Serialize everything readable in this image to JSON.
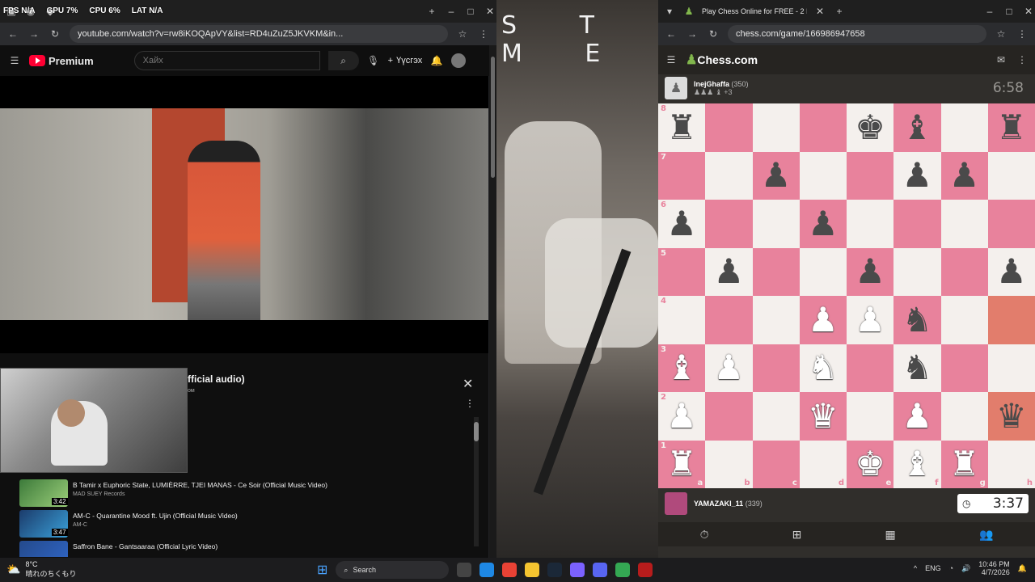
{
  "overlay": {
    "fps": "FPS N/A",
    "gpu": "GPU 7%",
    "cpu": "CPU 6%",
    "lat": "LAT N/A"
  },
  "youtube": {
    "url": "youtube.com/watch?v=rw8iKOQApVY&list=RD4uZuZ5JKVKM&in...",
    "logo": "Premium",
    "search_placeholder": "Хайх",
    "create_label": "Үүсгэх",
    "playlist_title": "fficial audio)",
    "playlist_sub": "ом",
    "items": [
      {
        "title": "B Tamir x Euphoric State, LUMIÈRRE, TJEI MANAS - Ce Soir (Official Music Video)",
        "channel": "MAD SUEY Records",
        "duration": "3:42"
      },
      {
        "title": "AM-C - Quarantine Mood ft. Ujin (Official Music Video)",
        "channel": "AM-C",
        "duration": "3:47"
      },
      {
        "title": "Saffron Bane - Gantsaaraa (Official Lyric Video)",
        "channel": "",
        "duration": ""
      }
    ]
  },
  "wallpaper_text": "S T M E",
  "chess": {
    "tab_title": "Play Chess Online for FREE - 2 I",
    "url": "chess.com/game/166986947658",
    "logo_text": "Chess.com",
    "top_player": {
      "name": "InejGhaffa",
      "rating": "(350)",
      "clock": "6:58",
      "captures": "+3"
    },
    "bottom_player": {
      "name": "YAMAZAKI_11",
      "rating": "(339)",
      "clock": "3:37"
    },
    "board": [
      [
        "br",
        "",
        "",
        "",
        "bk",
        "bb",
        "",
        "br"
      ],
      [
        "",
        "",
        "bp",
        "",
        "",
        "bp",
        "bp",
        ""
      ],
      [
        "bp",
        "",
        "",
        "bp",
        "",
        "",
        "",
        ""
      ],
      [
        "",
        "bp",
        "",
        "",
        "bp",
        "",
        "",
        "bp"
      ],
      [
        "",
        "",
        "",
        "wp",
        "wp",
        "bn",
        "",
        ""
      ],
      [
        "wb",
        "wp",
        "",
        "wn",
        "",
        "bn",
        "",
        ""
      ],
      [
        "wp",
        "",
        "",
        "wq",
        "",
        "wp",
        "",
        "bq"
      ],
      [
        "wr",
        "",
        "",
        "",
        "wk",
        "wb",
        "wr",
        ""
      ]
    ],
    "highlight": [
      "h4",
      "h2"
    ],
    "files": [
      "a",
      "b",
      "c",
      "d",
      "e",
      "f",
      "g",
      "h"
    ],
    "ranks": [
      "8",
      "7",
      "6",
      "5",
      "4",
      "3",
      "2",
      "1"
    ]
  },
  "taskbar": {
    "temp": "8°C",
    "weather": "晴れのちくもり",
    "search": "Search",
    "lang": "ENG",
    "time": "10:46 PM",
    "date": "4/7/2026"
  }
}
